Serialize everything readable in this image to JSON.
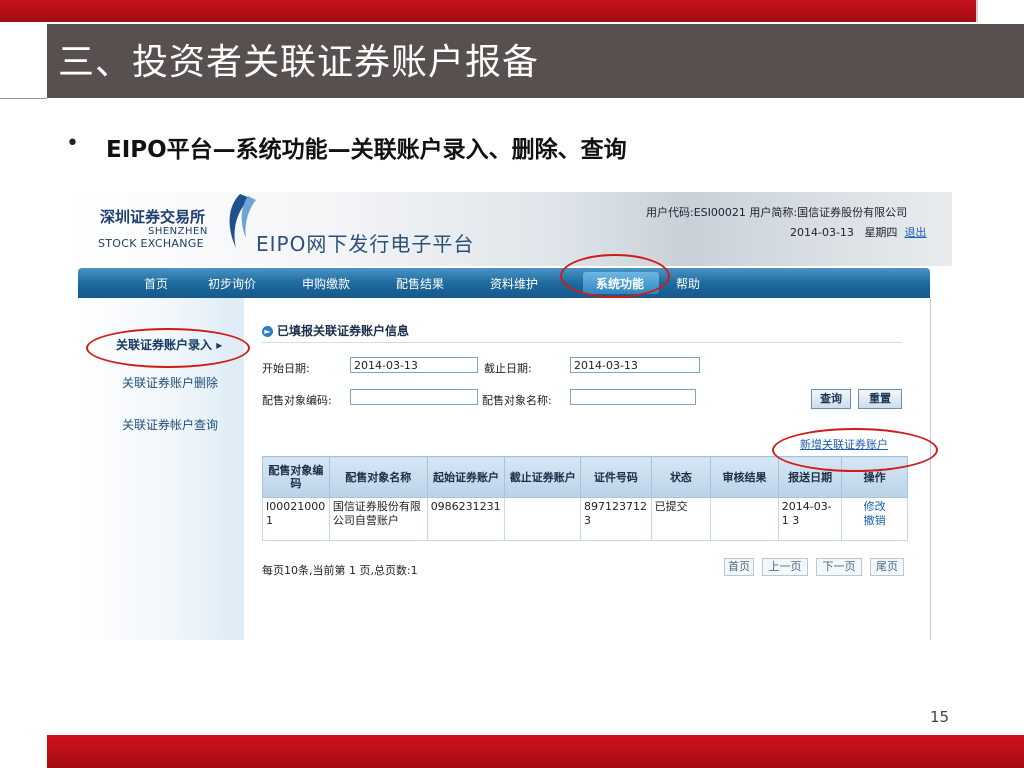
{
  "slide": {
    "title": "三、投资者关联证券账户报备",
    "bullet": "•",
    "bullet_text": "EIPO平台—系统功能—关联账户录入、删除、查询",
    "page_number": "15"
  },
  "app": {
    "logo_cn": "深圳证券交易所",
    "logo_en_line1": "SHENZHEN",
    "logo_en_line2": "STOCK EXCHANGE",
    "platform_title": "EIPO网下发行电子平台",
    "user_info": "用户代码:ESI00021  用户简称:国信证券股份有限公司",
    "date": "2014-03-13",
    "weekday": "星期四",
    "logout": "退出"
  },
  "nav": {
    "items": [
      "首页",
      "初步询价",
      "申购缴款",
      "配售结果",
      "资料维护",
      "系统功能",
      "帮助"
    ],
    "active": "系统功能"
  },
  "sidebar": {
    "items": [
      "关联证券账户录入",
      "关联证券账户删除",
      "关联证券帐户查询"
    ],
    "active_arrow": "▸"
  },
  "form": {
    "section_title": "已填报关联证券账户信息",
    "start_date_label": "开始日期:",
    "start_date_value": "2014-03-13",
    "end_date_label": "截止日期:",
    "end_date_value": "2014-03-13",
    "code_label": "配售对象编码:",
    "code_value": "",
    "name_label": "配售对象名称:",
    "name_value": "",
    "query_button": "查询",
    "reset_button": "重置",
    "add_link": "新增关联证券账户"
  },
  "table": {
    "headers": [
      "配售对象编码",
      "配售对象名称",
      "起始证券账户",
      "截止证券账户",
      "证件号码",
      "状态",
      "审核结果",
      "报送日期",
      "操作"
    ],
    "rows": [
      {
        "code": "I00021000 1",
        "name": "国信证券股份有限公司自营账户",
        "start_account": "0986231231",
        "end_account": "",
        "id_number": "897123712 3",
        "status": "已提交",
        "review": "",
        "date": "2014-03-1 3",
        "op_edit": "修改",
        "op_cancel": "撤销"
      }
    ]
  },
  "pager": {
    "summary": "每页10条,当前第 1 页,总页数:1",
    "first": "首页",
    "prev": "上一页",
    "next": "下一页",
    "last": "尾页"
  },
  "colors": {
    "slide_red": "#c8101a",
    "title_bg": "#57504e",
    "nav_blue": "#1e6a9e",
    "annotation_red": "#d21a1a"
  }
}
